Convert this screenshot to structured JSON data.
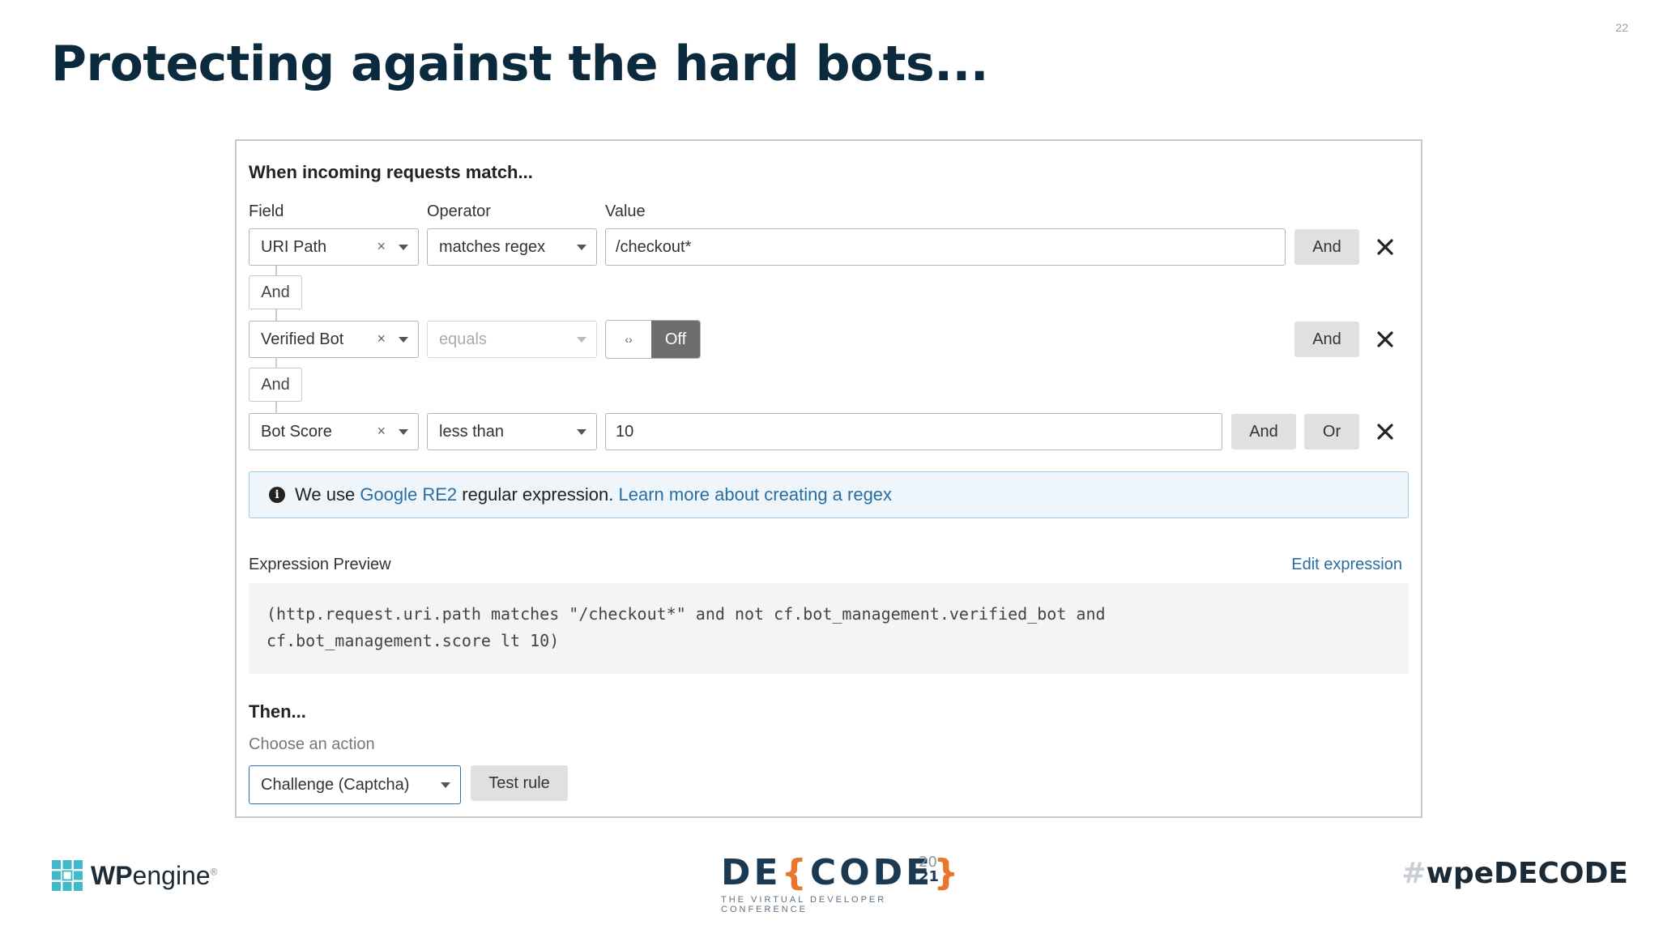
{
  "slide": {
    "page_number": "22",
    "title": "Protecting against the hard bots..."
  },
  "rule": {
    "heading": "When incoming requests match...",
    "columns": {
      "field": "Field",
      "operator": "Operator",
      "value": "Value"
    },
    "rows": [
      {
        "field": "URI Path",
        "operator": "matches regex",
        "value": "/checkout*",
        "buttons": [
          "And"
        ]
      },
      {
        "field": "Verified Bot",
        "operator": "equals",
        "toggle": "Off",
        "buttons": [
          "And"
        ]
      },
      {
        "field": "Bot Score",
        "operator": "less than",
        "value": "10",
        "buttons": [
          "And",
          "Or"
        ]
      }
    ],
    "connectors": [
      "And",
      "And"
    ],
    "clear_symbol": "×",
    "toggle_handle": "‹›",
    "info": {
      "icon": "info-icon",
      "prefix": "We use ",
      "link1": "Google RE2",
      "middle": " regular expression. ",
      "link2": "Learn more about creating a regex"
    },
    "preview": {
      "label": "Expression Preview",
      "edit_link": "Edit expression",
      "line1": "(http.request.uri.path matches \"/checkout*\" and not cf.bot_management.verified_bot and",
      "line2": "cf.bot_management.score lt 10)"
    },
    "then": {
      "heading": "Then...",
      "choose_label": "Choose an action",
      "action_value": "Challenge (Captcha)",
      "test_button": "Test rule"
    }
  },
  "footer": {
    "left_logo_bold": "WP",
    "left_logo_text": "engine",
    "left_logo_mark": "®",
    "center_de": "DE",
    "center_open": "{",
    "center_code": "CODE",
    "center_close": "}",
    "center_year_top": "20",
    "center_year_bottom": "21",
    "center_sub": "THE VIRTUAL DEVELOPER CONFERENCE",
    "right_hash": "#",
    "right_tag": "wpeDECODE"
  },
  "colors": {
    "title": "#0b2a3d",
    "link": "#2a6da0",
    "accent": "#e8772e"
  }
}
